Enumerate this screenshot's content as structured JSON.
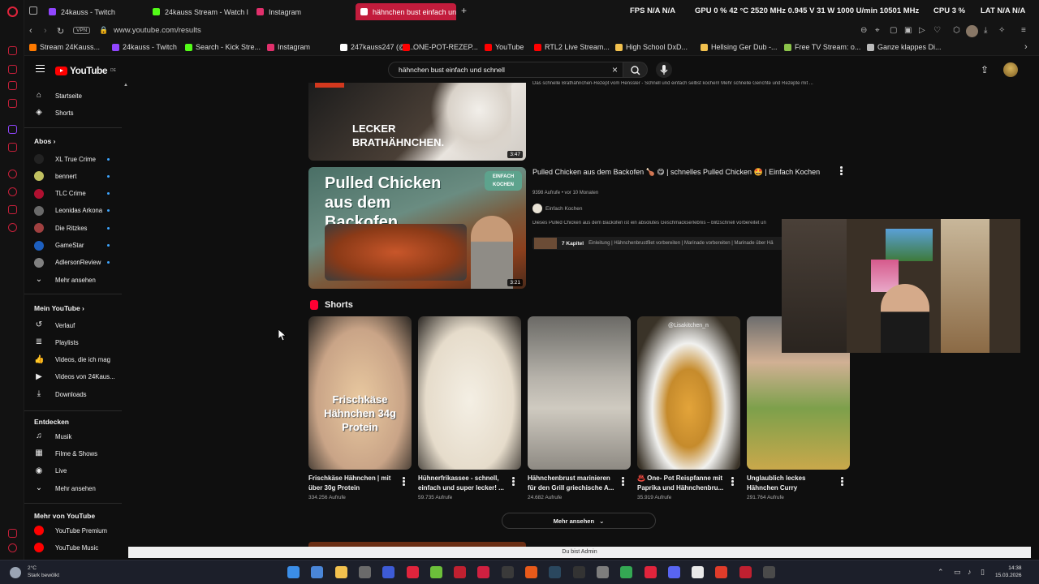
{
  "browser": {
    "tabs": [
      {
        "label": "24kauss - Twitch",
        "color": "#9146ff"
      },
      {
        "label": "24kauss Stream - Watch l",
        "color": "#53fc18"
      },
      {
        "label": "Instagram",
        "color": "#e1306c"
      },
      {
        "label": "hähnchen bust einfach un",
        "color": "#ff0000",
        "active": true
      }
    ],
    "new_tab": "+",
    "url": "www.youtube.com/results",
    "vpn_label": "VPN",
    "overlay_stats": {
      "fps": "FPS N/A N/A",
      "gpu": "GPU 0 % 42 °C 2520 MHz 0.945 V 31 W 1000 U/min 10501 MHz",
      "cpu": "CPU 3 %",
      "lat": "LAT N/A N/A"
    },
    "bookmarks": [
      {
        "label": "Stream 24Kauss...",
        "color": "#ff7a00"
      },
      {
        "label": "24kauss - Twitch",
        "color": "#9146ff"
      },
      {
        "label": "Search - Kick Stre...",
        "color": "#53fc18"
      },
      {
        "label": "Instagram",
        "color": "#e1306c"
      },
      {
        "label": "247kauss247 (@2...",
        "color": "#ffffff"
      },
      {
        "label": "ONE-POT-REZEP...",
        "color": "#ff0000"
      },
      {
        "label": "YouTube",
        "color": "#ff0000"
      },
      {
        "label": "RTL2 Live Stream...",
        "color": "#ff0000"
      },
      {
        "label": "High School DxD...",
        "color": "#f2c14e"
      },
      {
        "label": "Hellsing Ger Dub -...",
        "color": "#f2c14e"
      },
      {
        "label": "Free TV Stream: o...",
        "color": "#8bc34a"
      },
      {
        "label": "Ganze klappes Di...",
        "color": "#bbbbbb"
      }
    ]
  },
  "youtube": {
    "logo": "YouTube",
    "logo_region": "DE",
    "search_value": "hähnchen bust einfach und schnell"
  },
  "sidebar": {
    "main": [
      {
        "label": "Startseite",
        "icon": "home-icon"
      },
      {
        "label": "Shorts",
        "icon": "shorts-icon"
      }
    ],
    "abos_heading": "Abos",
    "subscriptions": [
      {
        "label": "XL True Crime",
        "color": "#222222"
      },
      {
        "label": "bennert",
        "color": "#c0c060"
      },
      {
        "label": "TLC Crime",
        "color": "#b01030"
      },
      {
        "label": "Leonidas Arkona",
        "color": "#6a6a6a"
      },
      {
        "label": "Die Ritzkes",
        "color": "#a04040"
      },
      {
        "label": "GameStar",
        "color": "#1d5fbf"
      },
      {
        "label": "AdlersonReview",
        "color": "#808080"
      }
    ],
    "subs_more": "Mehr ansehen",
    "my_heading": "Mein YouTube",
    "my_items": [
      {
        "label": "Verlauf",
        "icon": "history-icon"
      },
      {
        "label": "Playlists",
        "icon": "playlist-icon"
      },
      {
        "label": "Videos, die ich mag",
        "icon": "like-icon"
      },
      {
        "label": "Videos von 24Kaus...",
        "icon": "your-videos-icon"
      },
      {
        "label": "Downloads",
        "icon": "download-icon"
      }
    ],
    "explore_heading": "Entdecken",
    "explore_items": [
      {
        "label": "Musik",
        "icon": "music-icon"
      },
      {
        "label": "Filme & Shows",
        "icon": "film-icon"
      },
      {
        "label": "Live",
        "icon": "live-icon"
      }
    ],
    "explore_more": "Mehr ansehen",
    "more_heading": "Mehr von YouTube",
    "more_items": [
      {
        "label": "YouTube Premium"
      },
      {
        "label": "YouTube Music"
      }
    ]
  },
  "results": {
    "video1": {
      "thumb_text": "LECKER BRATHÄHNCHEN.",
      "duration": "3:47",
      "description": "Das schnelle Brathähnchen-Rezept vom Henssler - Schnell und einfach selbst kochen! Mehr schnelle Gerichte und Rezepte mit ..."
    },
    "video2": {
      "thumb_text": "Pulled Chicken aus dem Backofen",
      "badge": "EINFACH KOCHEN",
      "duration": "3:21",
      "title": "Pulled Chicken aus dem Backofen 🍗 😋 | schnelles Pulled Chicken 🤩 | Einfach Kochen",
      "meta": "9398 Aufrufe • vor 10 Monaten",
      "channel": "Einfach Kochen",
      "description": "Dieses Pulled Chicken aus dem Backofen ist ein absolutes Geschmackserlebnis – blitzschnell vorbereitet un",
      "chapters_label": "7 Kapitel",
      "chapters_text": "Einleitung | Hähnchenbrustfilet vorbereiten | Marinade vorbereiten | Marinade über Hä"
    },
    "shorts_heading": "Shorts",
    "shorts": [
      {
        "title": "Frischkäse Hähnchen | mit über 30g Protein",
        "views": "334.256 Aufrufe",
        "overlay": "Frischkäse Hähnchen 34g Protein",
        "bg": "#c9a487"
      },
      {
        "title": "Hühnerfrikassee - schnell, einfach und super lecker! ...",
        "views": "59.735 Aufrufe",
        "overlay": "",
        "bg": "#e6dccb"
      },
      {
        "title": "Hähnchenbrust marinieren für den Grill griechische A...",
        "views": "24.682 Aufrufe",
        "overlay": "",
        "bg": "#8e8a83"
      },
      {
        "title": "♨️ One- Pot Reispfanne mit Paprika und Hähnchenbru...",
        "views": "35.919 Aufrufe",
        "overlay": "@Lisakitchen_n",
        "bg": "#3a3328"
      },
      {
        "title": "Unglaublich leckes Hähnchen Curry",
        "views": "291.764 Aufrufe",
        "overlay": "",
        "bg": "#b9a98c"
      }
    ],
    "shorts_more": "Mehr ansehen"
  },
  "hint_bar": "Du bist Admin",
  "taskbar": {
    "weather_temp": "2°C",
    "weather_desc": "Stark bewölkt",
    "time": "14:38",
    "date": "15.03.2026"
  }
}
